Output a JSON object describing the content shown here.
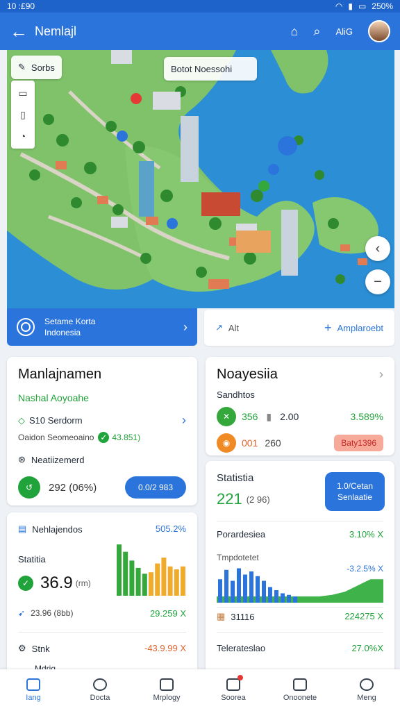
{
  "status_bar": {
    "time": "10 :£90",
    "battery": "250%"
  },
  "app_bar": {
    "title": "Nemlajl",
    "action_label": "AliG"
  },
  "map": {
    "search_chip": "Sorbs",
    "location_chip": "Botot Noessohi"
  },
  "region": {
    "button_label_line1": "Setame Korta",
    "button_label_line2": "Indonesia",
    "edit_label": "Alt",
    "add_label": "Amplaroebt"
  },
  "card_left1": {
    "title": "Manlajnamen",
    "subtitle": "Nashal Aoyoahe",
    "line1": "S10 Serdorm",
    "line2_label": "Oaidon Seomeoaino",
    "line2_value": "43.851)",
    "line3": "Neatiizemerd",
    "value": "292 (06%)",
    "button": "0.0/2 983"
  },
  "card_right1": {
    "title": "Noayesiia",
    "subtitle": "Sandhtos",
    "row1_a": "356",
    "row1_b": "2.00",
    "row1_pct": "3.589%",
    "row2_a": "001",
    "row2_b": "260",
    "row2_badge": "Baty1396"
  },
  "card_right2": {
    "title": "Statistia",
    "value": "221",
    "value_sub": "(2 96)",
    "button_line1": "1.0/Cetan",
    "button_line2": "Senlaatie",
    "section1": "Porardesiea",
    "section1_pct": "3.10% X",
    "chart_label": "Tmpdotetet",
    "chart_pct": "-3.2.5% X",
    "footer_a": "31116",
    "footer_b": "224275 X",
    "section2": "Telerateslao",
    "section2_pct": "27.0%X"
  },
  "card_left2": {
    "header": "Nehlajendos",
    "header_pct": "505.2%",
    "stat_label": "Statitia",
    "stat_value": "36.9",
    "stat_unit": "(rm)",
    "row_a": "23.96 (8bb)",
    "row_a_pct": "29.259 X",
    "row_b": "Stnk",
    "row_b_pct": "-43.9.99 X",
    "row_c": "Mdriq"
  },
  "chart_data": [
    {
      "type": "bar",
      "series": [
        {
          "name": "",
          "color": "#35a83c",
          "values": [
            70,
            60,
            48,
            38,
            30
          ]
        },
        {
          "name": "",
          "color": "#f0ab2c",
          "values": [
            32,
            44,
            52,
            40,
            36,
            40
          ]
        }
      ]
    },
    {
      "type": "bar",
      "values": [
        30,
        42,
        28,
        44,
        36,
        40,
        34,
        28,
        20,
        16,
        12,
        10,
        8
      ],
      "area_values": [
        8,
        8,
        8,
        8,
        8,
        8,
        8,
        8,
        8,
        10,
        14,
        22,
        30,
        30
      ]
    }
  ],
  "bottom_nav": [
    {
      "label": "Iang"
    },
    {
      "label": "Docta"
    },
    {
      "label": "Mrplogy"
    },
    {
      "label": "Soorea"
    },
    {
      "label": "Onoonete"
    },
    {
      "label": "Meng"
    }
  ],
  "colors": {
    "primary": "#2b74db",
    "green": "#1fa33a",
    "orange": "#e2622d",
    "water": "#2c8fd6"
  }
}
